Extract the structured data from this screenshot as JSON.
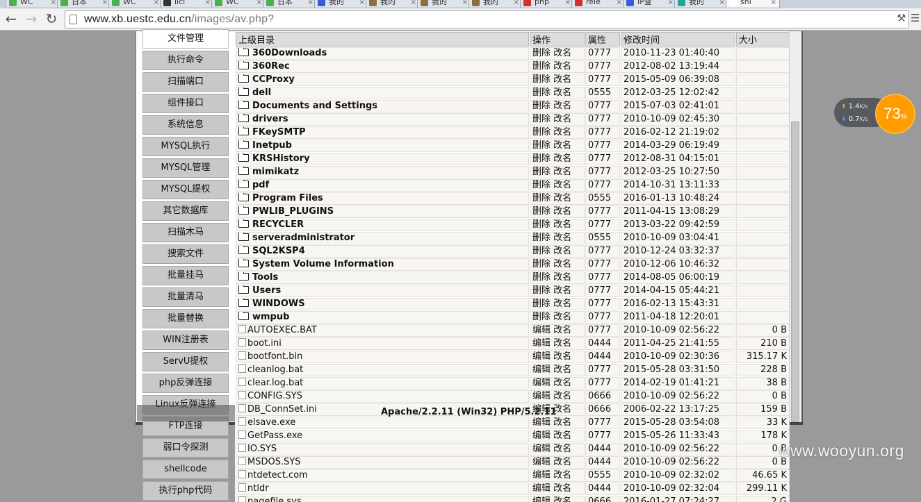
{
  "browser": {
    "tabs": [
      {
        "label": "WC",
        "color": "#4caf50"
      },
      {
        "label": "日本",
        "color": "#4caf50"
      },
      {
        "label": "WC",
        "color": "#4caf50"
      },
      {
        "label": "lici",
        "color": "#333333"
      },
      {
        "label": "WC",
        "color": "#4caf50"
      },
      {
        "label": "日本",
        "color": "#4caf50"
      },
      {
        "label": "我的",
        "color": "#3b5bdb"
      },
      {
        "label": "我的",
        "color": "#8d6e3f"
      },
      {
        "label": "我的",
        "color": "#8d6e3f"
      },
      {
        "label": "我的",
        "color": "#8d6e3f"
      },
      {
        "label": "php",
        "color": "#d32f2f"
      },
      {
        "label": "rele",
        "color": "#d32f2f"
      },
      {
        "label": "IP查",
        "color": "#3b5bdb"
      },
      {
        "label": "我的",
        "color": "#26a69a"
      },
      {
        "label": "shi",
        "color": "#ffffff"
      }
    ],
    "url_host": "www.xb.uestc.edu.cn",
    "url_path": "/images/av.php?"
  },
  "sidebar": {
    "items": [
      "文件管理",
      "执行命令",
      "扫描端口",
      "组件接口",
      "系统信息",
      "MYSQL执行",
      "MYSQL管理",
      "MYSQL提权",
      "其它数据库",
      "扫描木马",
      "搜索文件",
      "批量挂马",
      "批量清马",
      "批量替换",
      "WIN注册表",
      "ServU提权",
      "php反弹连接",
      "Linux反弹连接",
      "FTP连接",
      "弱口令探测",
      "shellcode",
      "执行php代码"
    ]
  },
  "table": {
    "headers": {
      "name": "上级目录",
      "ops": "操作",
      "perm": "属性",
      "mtime": "修改时间",
      "size": "大小"
    },
    "dirs": [
      {
        "name": "360Downloads",
        "ops": "删除 改名",
        "perm": "0777",
        "mtime": "2010-11-23 01:40:40"
      },
      {
        "name": "360Rec",
        "ops": "删除 改名",
        "perm": "0777",
        "mtime": "2012-08-02 13:19:44"
      },
      {
        "name": "CCProxy",
        "ops": "删除 改名",
        "perm": "0777",
        "mtime": "2015-05-09 06:39:08"
      },
      {
        "name": "dell",
        "ops": "删除 改名",
        "perm": "0555",
        "mtime": "2012-03-25 12:02:42"
      },
      {
        "name": "Documents and Settings",
        "ops": "删除 改名",
        "perm": "0777",
        "mtime": "2015-07-03 02:41:01"
      },
      {
        "name": "drivers",
        "ops": "删除 改名",
        "perm": "0777",
        "mtime": "2010-10-09 02:45:30"
      },
      {
        "name": "FKeySMTP",
        "ops": "删除 改名",
        "perm": "0777",
        "mtime": "2016-02-12 21:19:02"
      },
      {
        "name": "Inetpub",
        "ops": "删除 改名",
        "perm": "0777",
        "mtime": "2014-03-29 06:19:49"
      },
      {
        "name": "KRSHistory",
        "ops": "删除 改名",
        "perm": "0777",
        "mtime": "2012-08-31 04:15:01"
      },
      {
        "name": "mimikatz",
        "ops": "删除 改名",
        "perm": "0777",
        "mtime": "2012-03-25 10:27:50"
      },
      {
        "name": "pdf",
        "ops": "删除 改名",
        "perm": "0777",
        "mtime": "2014-10-31 13:11:33"
      },
      {
        "name": "Program Files",
        "ops": "删除 改名",
        "perm": "0555",
        "mtime": "2016-01-13 10:48:24"
      },
      {
        "name": "PWLIB_PLUGINS",
        "ops": "删除 改名",
        "perm": "0777",
        "mtime": "2011-04-15 13:08:29"
      },
      {
        "name": "RECYCLER",
        "ops": "删除 改名",
        "perm": "0777",
        "mtime": "2013-03-22 09:42:59"
      },
      {
        "name": "serveradministrator",
        "ops": "删除 改名",
        "perm": "0555",
        "mtime": "2010-10-09 03:04:41"
      },
      {
        "name": "SQL2KSP4",
        "ops": "删除 改名",
        "perm": "0777",
        "mtime": "2010-12-24 03:32:37"
      },
      {
        "name": "System Volume Information",
        "ops": "删除 改名",
        "perm": "0777",
        "mtime": "2010-12-06 10:46:32"
      },
      {
        "name": "Tools",
        "ops": "删除 改名",
        "perm": "0777",
        "mtime": "2014-08-05 06:00:19"
      },
      {
        "name": "Users",
        "ops": "删除 改名",
        "perm": "0777",
        "mtime": "2014-04-15 05:44:21"
      },
      {
        "name": "WINDOWS",
        "ops": "删除 改名",
        "perm": "0777",
        "mtime": "2016-02-13 15:43:31"
      },
      {
        "name": "wmpub",
        "ops": "删除 改名",
        "perm": "0777",
        "mtime": "2011-04-18 12:20:01"
      }
    ],
    "files": [
      {
        "name": "AUTOEXEC.BAT",
        "ops": "编辑 改名",
        "perm": "0777",
        "mtime": "2010-10-09 02:56:22",
        "size": "0 B"
      },
      {
        "name": "boot.ini",
        "ops": "编辑 改名",
        "perm": "0444",
        "mtime": "2011-04-25 21:41:55",
        "size": "210 B"
      },
      {
        "name": "bootfont.bin",
        "ops": "编辑 改名",
        "perm": "0444",
        "mtime": "2010-10-09 02:30:36",
        "size": "315.17 K"
      },
      {
        "name": "cleanlog.bat",
        "ops": "编辑 改名",
        "perm": "0777",
        "mtime": "2015-05-28 03:31:50",
        "size": "228 B"
      },
      {
        "name": "clear.log.bat",
        "ops": "编辑 改名",
        "perm": "0777",
        "mtime": "2014-02-19 01:41:21",
        "size": "38 B"
      },
      {
        "name": "CONFIG.SYS",
        "ops": "编辑 改名",
        "perm": "0666",
        "mtime": "2010-10-09 02:56:22",
        "size": "0 B"
      },
      {
        "name": "DB_ConnSet.ini",
        "ops": "编辑 改名",
        "perm": "0666",
        "mtime": "2006-02-22 13:17:25",
        "size": "159 B"
      },
      {
        "name": "elsave.exe",
        "ops": "编辑 改名",
        "perm": "0777",
        "mtime": "2015-05-28 03:54:08",
        "size": "33 K"
      },
      {
        "name": "GetPass.exe",
        "ops": "编辑 改名",
        "perm": "0777",
        "mtime": "2015-05-26 11:33:43",
        "size": "178 K"
      },
      {
        "name": "IO.SYS",
        "ops": "编辑 改名",
        "perm": "0444",
        "mtime": "2010-10-09 02:56:22",
        "size": "0 B"
      },
      {
        "name": "MSDOS.SYS",
        "ops": "编辑 改名",
        "perm": "0444",
        "mtime": "2010-10-09 02:56:22",
        "size": "0 B"
      },
      {
        "name": "ntdetect.com",
        "ops": "编辑 改名",
        "perm": "0555",
        "mtime": "2010-10-09 02:32:02",
        "size": "46.65 K"
      },
      {
        "name": "ntldr",
        "ops": "编辑 改名",
        "perm": "0444",
        "mtime": "2010-10-09 02:32:04",
        "size": "299.11 K"
      },
      {
        "name": "pagefile.sys",
        "ops": "编辑 改名",
        "perm": "0666",
        "mtime": "2016-01-27 07:24:27",
        "size": "2 G"
      }
    ]
  },
  "server_info": "Apache/2.2.11 (Win32) PHP/5.2.11",
  "speed_widget": {
    "up": "1.4",
    "down": "0.7",
    "unit": "K/s",
    "percent": "73",
    "percent_sign": "%",
    "ball_color": "#ff9c00"
  },
  "watermark": "www.wooyun.org"
}
